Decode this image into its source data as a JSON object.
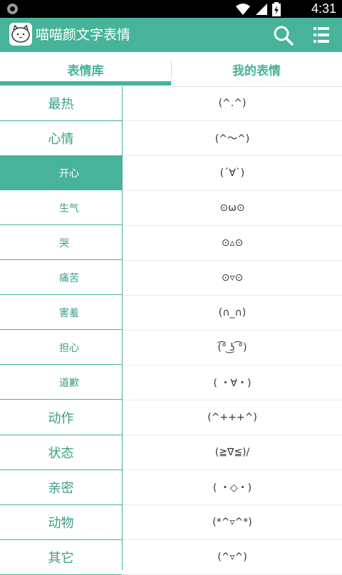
{
  "status_bar": {
    "time": "4:31"
  },
  "app_bar": {
    "title": "喵喵颜文字表情"
  },
  "tabs": [
    {
      "label": "表情库",
      "active": true
    },
    {
      "label": "我的表情",
      "active": false
    }
  ],
  "categories": [
    {
      "label": "最热",
      "level": "main"
    },
    {
      "label": "心情",
      "level": "main"
    },
    {
      "label": "开心",
      "level": "sub",
      "active": true
    },
    {
      "label": "生气",
      "level": "sub"
    },
    {
      "label": "哭",
      "level": "sub"
    },
    {
      "label": "痛苦",
      "level": "sub"
    },
    {
      "label": "害羞",
      "level": "sub"
    },
    {
      "label": "担心",
      "level": "sub"
    },
    {
      "label": "道歉",
      "level": "sub"
    },
    {
      "label": "动作",
      "level": "main"
    },
    {
      "label": "状态",
      "level": "main"
    },
    {
      "label": "亲密",
      "level": "main"
    },
    {
      "label": "动物",
      "level": "main"
    },
    {
      "label": "其它",
      "level": "main"
    }
  ],
  "emoticons": [
    "(^.^)",
    "(^～^)",
    "(´∀`)",
    "⊙ω⊙",
    "⊙▵⊙",
    "⊙▿⊙",
    "(∩_∩)",
    "(͡° ͜ʖ ͡°)",
    "( ・∀・)",
    "(^+++^)",
    "(≧∇≦)/",
    "( ・◇・)",
    "(*^▿^*)",
    "(^▿^)"
  ],
  "colors": {
    "accent": "#47b39a",
    "status_bar": "#000000"
  }
}
